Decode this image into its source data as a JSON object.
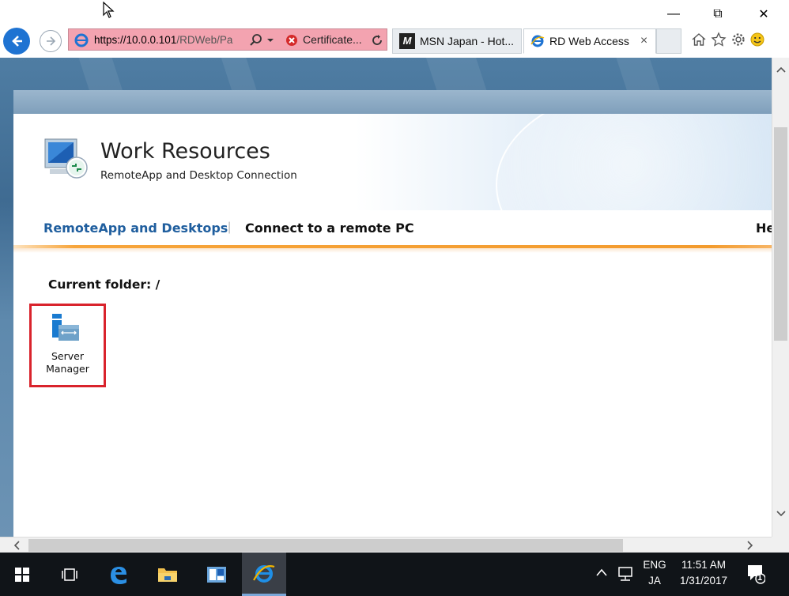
{
  "browser": {
    "address": {
      "url_host": "https://10.0.0.101",
      "url_rest": "/RDWeb/Pa",
      "cert_label": "Certificate..."
    },
    "tabs": [
      {
        "label": "MSN Japan - Hot...",
        "icon": "msn-icon"
      },
      {
        "label": "RD Web Access",
        "icon": "ie-icon",
        "close": "×"
      }
    ],
    "window_controls": {
      "minimize": "—",
      "restore": "⧉",
      "close": "✕"
    }
  },
  "page": {
    "title": "Work Resources",
    "subtitle": "RemoteApp and Desktop Connection",
    "nav": {
      "remoteapp": "RemoteApp and Desktops",
      "separator": "|",
      "connect": "Connect to a remote PC",
      "help": "He"
    },
    "current_folder": "Current folder: /",
    "apps": [
      {
        "label_line1": "Server",
        "label_line2": "Manager"
      }
    ]
  },
  "taskbar": {
    "lang_top": "ENG",
    "lang_bottom": "JA",
    "time": "11:51 AM",
    "date": "1/31/2017",
    "notification_count": "1"
  },
  "colors": {
    "accent_blue": "#1e73d2",
    "nav_link": "#1f5e9e",
    "highlight_red": "#d9232c",
    "orange_bar": "#f39b2d",
    "address_bar_error": "#f3a3b0"
  }
}
